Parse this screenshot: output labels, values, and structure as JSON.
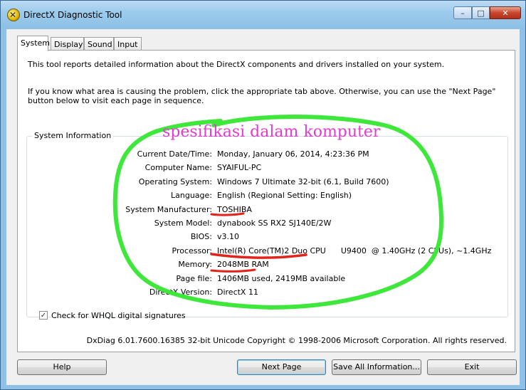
{
  "window": {
    "title": "DirectX Diagnostic Tool",
    "controls": {
      "minimize": "–",
      "maximize": "□",
      "close": "✕"
    }
  },
  "tabs": [
    {
      "label": "System",
      "active": true
    },
    {
      "label": "Display",
      "active": false
    },
    {
      "label": "Sound",
      "active": false
    },
    {
      "label": "Input",
      "active": false
    }
  ],
  "intro": {
    "line1": "This tool reports detailed information about the DirectX components and drivers installed on your system.",
    "line2": "If you know what area is causing the problem, click the appropriate tab above.  Otherwise, you can use the \"Next Page\" button below to visit each page in sequence."
  },
  "system_info": {
    "group_title": "System Information",
    "rows": [
      {
        "label": "Current Date/Time:",
        "value": "Monday, January 06, 2014, 4:23:36 PM"
      },
      {
        "label": "Computer Name:",
        "value": "SYAIFUL-PC"
      },
      {
        "label": "Operating System:",
        "value": "Windows 7 Ultimate 32-bit (6.1, Build 7600)"
      },
      {
        "label": "Language:",
        "value": "English (Regional Setting: English)"
      },
      {
        "label": "System Manufacturer:",
        "value": "TOSHIBA"
      },
      {
        "label": "System Model:",
        "value": "dynabook SS RX2 SJ140E/2W"
      },
      {
        "label": "BIOS:",
        "value": "v3.10"
      },
      {
        "label": "Processor:",
        "value": "Intel(R) Core(TM)2 Duo CPU      U9400  @ 1.40GHz (2 CPUs), ~1.4GHz"
      },
      {
        "label": "Memory:",
        "value": "2048MB RAM"
      },
      {
        "label": "Page file:",
        "value": "1406MB used, 2419MB available"
      },
      {
        "label": "DirectX Version:",
        "value": "DirectX 11"
      }
    ]
  },
  "whql": {
    "label": "Check for WHQL digital signatures",
    "checked": true,
    "mark": "✓"
  },
  "footer": "DxDiag 6.01.7600.16385 32-bit Unicode  Copyright © 1998-2006 Microsoft Corporation.  All rights reserved.",
  "buttons": {
    "help": "Help",
    "next": "Next Page",
    "save": "Save All Information...",
    "exit": "Exit"
  },
  "annotation": {
    "text": "spesifikasi dalam komputer",
    "text_color": "#e23bd0",
    "circle_color": "#3ee83a",
    "underline_color": "#e0241c"
  }
}
